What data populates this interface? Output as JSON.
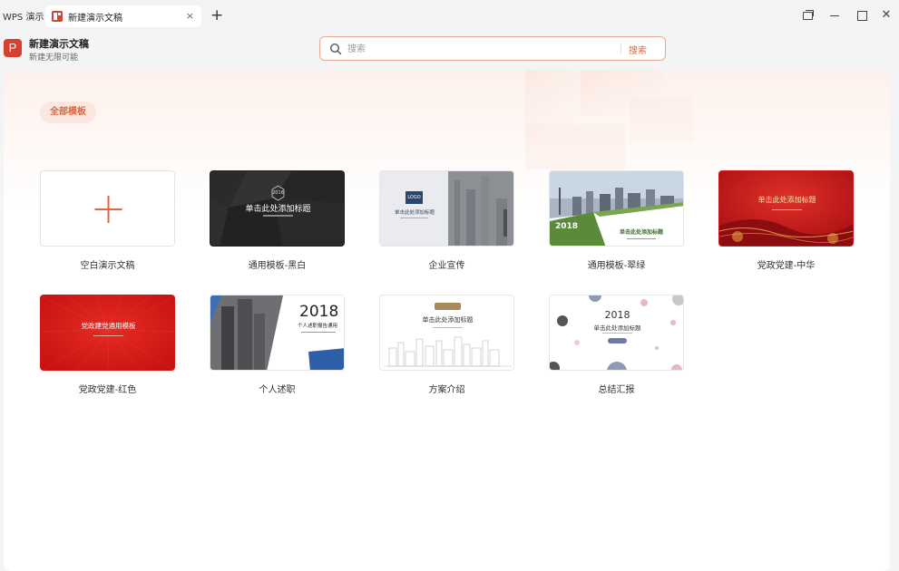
{
  "titlebar": {
    "app_name": "WPS 演示",
    "tab_title": "新建演示文稿",
    "tab_close": "×",
    "new_tab": "+"
  },
  "header": {
    "logo_letter": "P",
    "title": "新建演示文稿",
    "subtitle": "新建无限可能"
  },
  "search": {
    "placeholder": "搜索",
    "value": "",
    "button_label": "搜索"
  },
  "filter": {
    "label": "全部模板"
  },
  "templates": [
    {
      "label": "空白演示文稿"
    },
    {
      "label": "通用模板-黑白",
      "title": "单击此处添加标题",
      "badge": "2018"
    },
    {
      "label": "企业宣传",
      "title": "单击此处添加标题",
      "logo": "LOGO"
    },
    {
      "label": "通用模板-翠绿",
      "year": "2018",
      "title": "单击此处添加标题"
    },
    {
      "label": "党政党建-中华",
      "title": "单击此处添加标题"
    },
    {
      "label": "党政党建-红色",
      "title": "党政建党通用模板"
    },
    {
      "label": "个人述职",
      "year": "2018",
      "title": "个人述职报告通用"
    },
    {
      "label": "方案介绍",
      "title": "单击此处添加标题"
    },
    {
      "label": "总结汇报",
      "year": "2018",
      "title": "单击此处添加标题"
    }
  ],
  "colors": {
    "accent": "#e0663d",
    "brand_red": "#d8412f"
  }
}
